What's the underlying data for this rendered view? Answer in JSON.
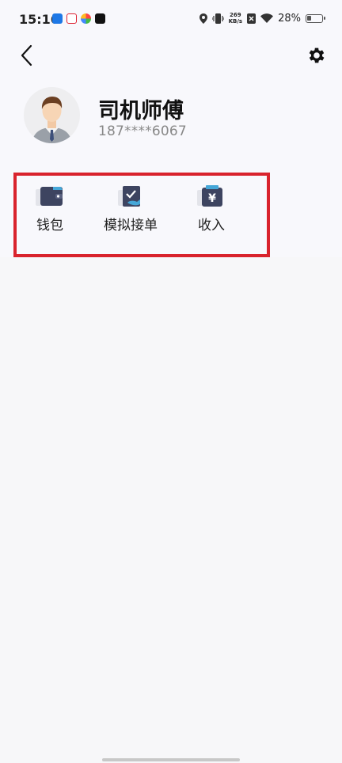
{
  "status_bar": {
    "time": "15:16",
    "net_speed_value": "269",
    "net_speed_unit": "KB/s",
    "battery": "28%"
  },
  "header": {
    "back_icon": "chevron-left-icon",
    "settings_icon": "gear-icon"
  },
  "profile": {
    "name": "司机师傅",
    "phone": "187****6067",
    "avatar_icon": "driver-avatar-icon"
  },
  "menu": {
    "items": [
      {
        "label": "钱包",
        "icon": "wallet-icon"
      },
      {
        "label": "模拟接单",
        "icon": "order-check-icon"
      },
      {
        "label": "收入",
        "icon": "income-yen-icon"
      }
    ]
  },
  "colors": {
    "icon_dark": "#3d4460",
    "icon_accent": "#45a7d8",
    "highlight_border": "#d9232d"
  }
}
